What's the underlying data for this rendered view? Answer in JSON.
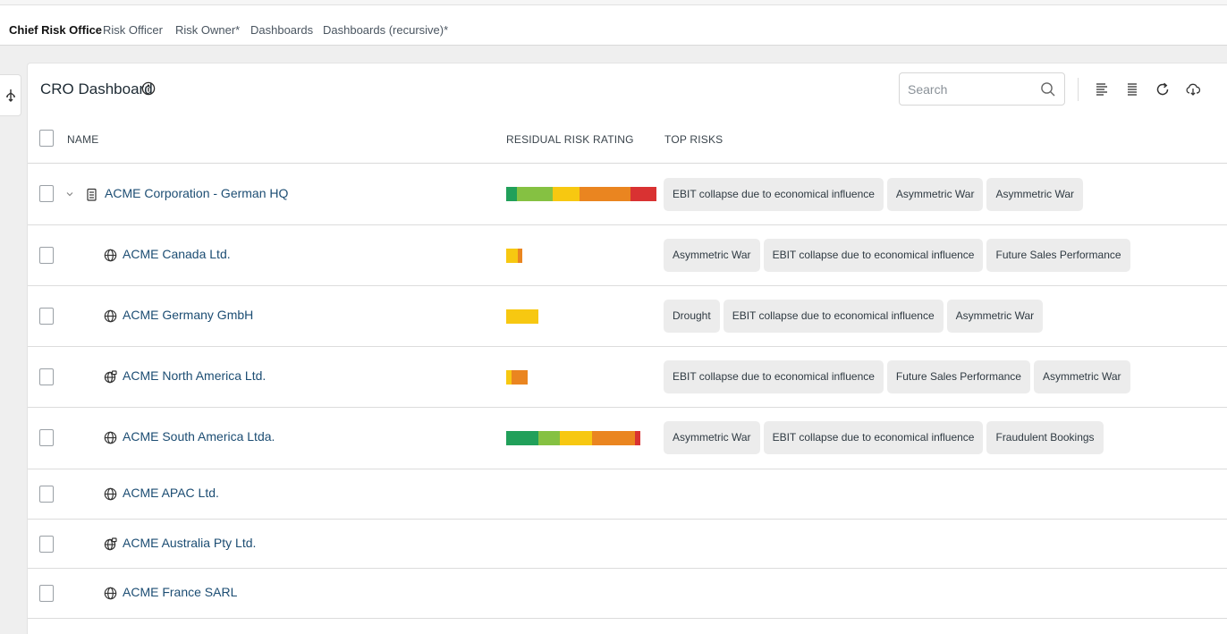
{
  "tabs": [
    {
      "label": "Chief Risk Office",
      "active": true
    },
    {
      "label": "Risk Officer"
    },
    {
      "label": "Risk Owner*"
    },
    {
      "label": "Dashboards"
    },
    {
      "label": "Dashboards (recursive)*"
    }
  ],
  "dashboard": {
    "title": "CRO Dashboard",
    "search_placeholder": "Search"
  },
  "toolbar_icons": [
    "align-left-icon",
    "align-justify-icon",
    "refresh-icon",
    "cloud-download-icon"
  ],
  "columns": {
    "name": "NAME",
    "rating": "RESIDUAL RISK RATING",
    "top_risks": "TOP RISKS"
  },
  "colors": {
    "dark_green": "#21a05a",
    "light_green": "#85c142",
    "yellow": "#f7c811",
    "orange": "#ea8520",
    "red": "#d93232",
    "link": "#1c4d73"
  },
  "rows": [
    {
      "name": "ACME Corporation - German HQ",
      "icon": "building-icon",
      "expandable": true,
      "rating": [
        {
          "color": "dark_green",
          "share": 0.07
        },
        {
          "color": "light_green",
          "share": 0.24
        },
        {
          "color": "yellow",
          "share": 0.18
        },
        {
          "color": "orange",
          "share": 0.34
        },
        {
          "color": "red",
          "share": 0.17
        }
      ],
      "risks": [
        "EBIT collapse due to economical influence",
        "Asymmetric War",
        "Asymmetric War"
      ]
    },
    {
      "name": "ACME Canada Ltd.",
      "icon": "globe-icon",
      "rating": [
        {
          "color": "yellow",
          "share": 0.72
        },
        {
          "color": "orange",
          "share": 0.28
        }
      ],
      "risks": [
        "Asymmetric War",
        "EBIT collapse due to economical influence",
        "Future Sales Performance"
      ]
    },
    {
      "name": "ACME Germany GmbH",
      "icon": "globe-icon",
      "rating": [
        {
          "color": "yellow",
          "share": 1.0
        }
      ],
      "risks": [
        "Drought",
        "EBIT collapse due to economical influence",
        "Asymmetric War"
      ]
    },
    {
      "name": "ACME North America Ltd.",
      "icon": "globe-lock-icon",
      "rating": [
        {
          "color": "yellow",
          "share": 0.25
        },
        {
          "color": "orange",
          "share": 0.75
        }
      ],
      "risks": [
        "EBIT collapse due to economical influence",
        "Future Sales Performance",
        "Asymmetric War"
      ]
    },
    {
      "name": "ACME South America Ltda.",
      "icon": "globe-icon",
      "rating": [
        {
          "color": "dark_green",
          "share": 0.24
        },
        {
          "color": "light_green",
          "share": 0.16
        },
        {
          "color": "yellow",
          "share": 0.24
        },
        {
          "color": "orange",
          "share": 0.32
        },
        {
          "color": "red",
          "share": 0.04
        }
      ],
      "risks": [
        "Asymmetric War",
        "EBIT collapse due to economical influence",
        "Fraudulent Bookings"
      ]
    },
    {
      "name": "ACME APAC Ltd.",
      "icon": "globe-icon",
      "rating": [],
      "risks": []
    },
    {
      "name": "ACME Australia Pty Ltd.",
      "icon": "globe-lock-icon",
      "rating": [],
      "risks": []
    },
    {
      "name": "ACME France SARL",
      "icon": "globe-icon",
      "rating": [],
      "risks": []
    }
  ]
}
